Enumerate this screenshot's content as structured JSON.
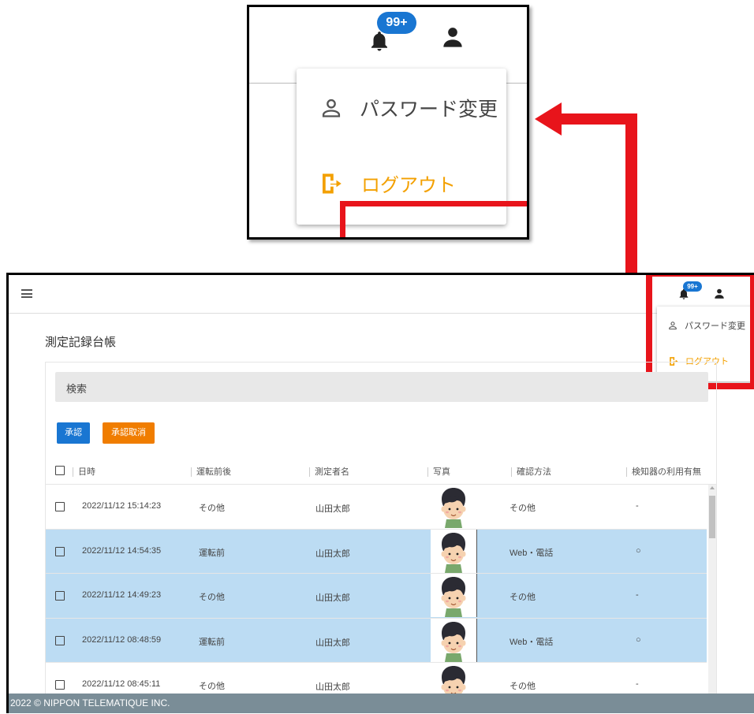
{
  "zoom_inset": {
    "notification_badge": "99+",
    "menu": {
      "change_password": "パスワード変更",
      "logout": "ログアウト"
    }
  },
  "app": {
    "header": {
      "notification_badge": "99+",
      "menu": {
        "change_password": "パスワード変更",
        "logout": "ログアウト"
      }
    },
    "page_title": "測定記録台帳",
    "search_label": "検索",
    "buttons": {
      "approve": "承認",
      "cancel_approval": "承認取消"
    },
    "table": {
      "columns": [
        "日時",
        "運転前後",
        "測定者名",
        "写真",
        "確認方法",
        "検知器の利用有無"
      ],
      "rows": [
        {
          "datetime": "2022/11/12 15:14:23",
          "timing": "その他",
          "name": "山田太郎",
          "method": "その他",
          "detector": "-",
          "selected": false
        },
        {
          "datetime": "2022/11/12 14:54:35",
          "timing": "運転前",
          "name": "山田太郎",
          "method": "Web・電話",
          "detector": "○",
          "selected": true
        },
        {
          "datetime": "2022/11/12 14:49:23",
          "timing": "その他",
          "name": "山田太郎",
          "method": "その他",
          "detector": "-",
          "selected": true
        },
        {
          "datetime": "2022/11/12 08:48:59",
          "timing": "運転前",
          "name": "山田太郎",
          "method": "Web・電話",
          "detector": "○",
          "selected": true
        },
        {
          "datetime": "2022/11/12 08:45:11",
          "timing": "その他",
          "name": "山田太郎",
          "method": "その他",
          "detector": "-",
          "selected": false
        }
      ]
    },
    "footer": "2022 © NIPPON TELEMATIQUE INC."
  },
  "colors": {
    "highlight_red": "#e8141b",
    "primary_blue": "#1976d2",
    "orange": "#f07d00",
    "selected_row": "#bcdcf3",
    "logout_text": "#f3a000"
  }
}
